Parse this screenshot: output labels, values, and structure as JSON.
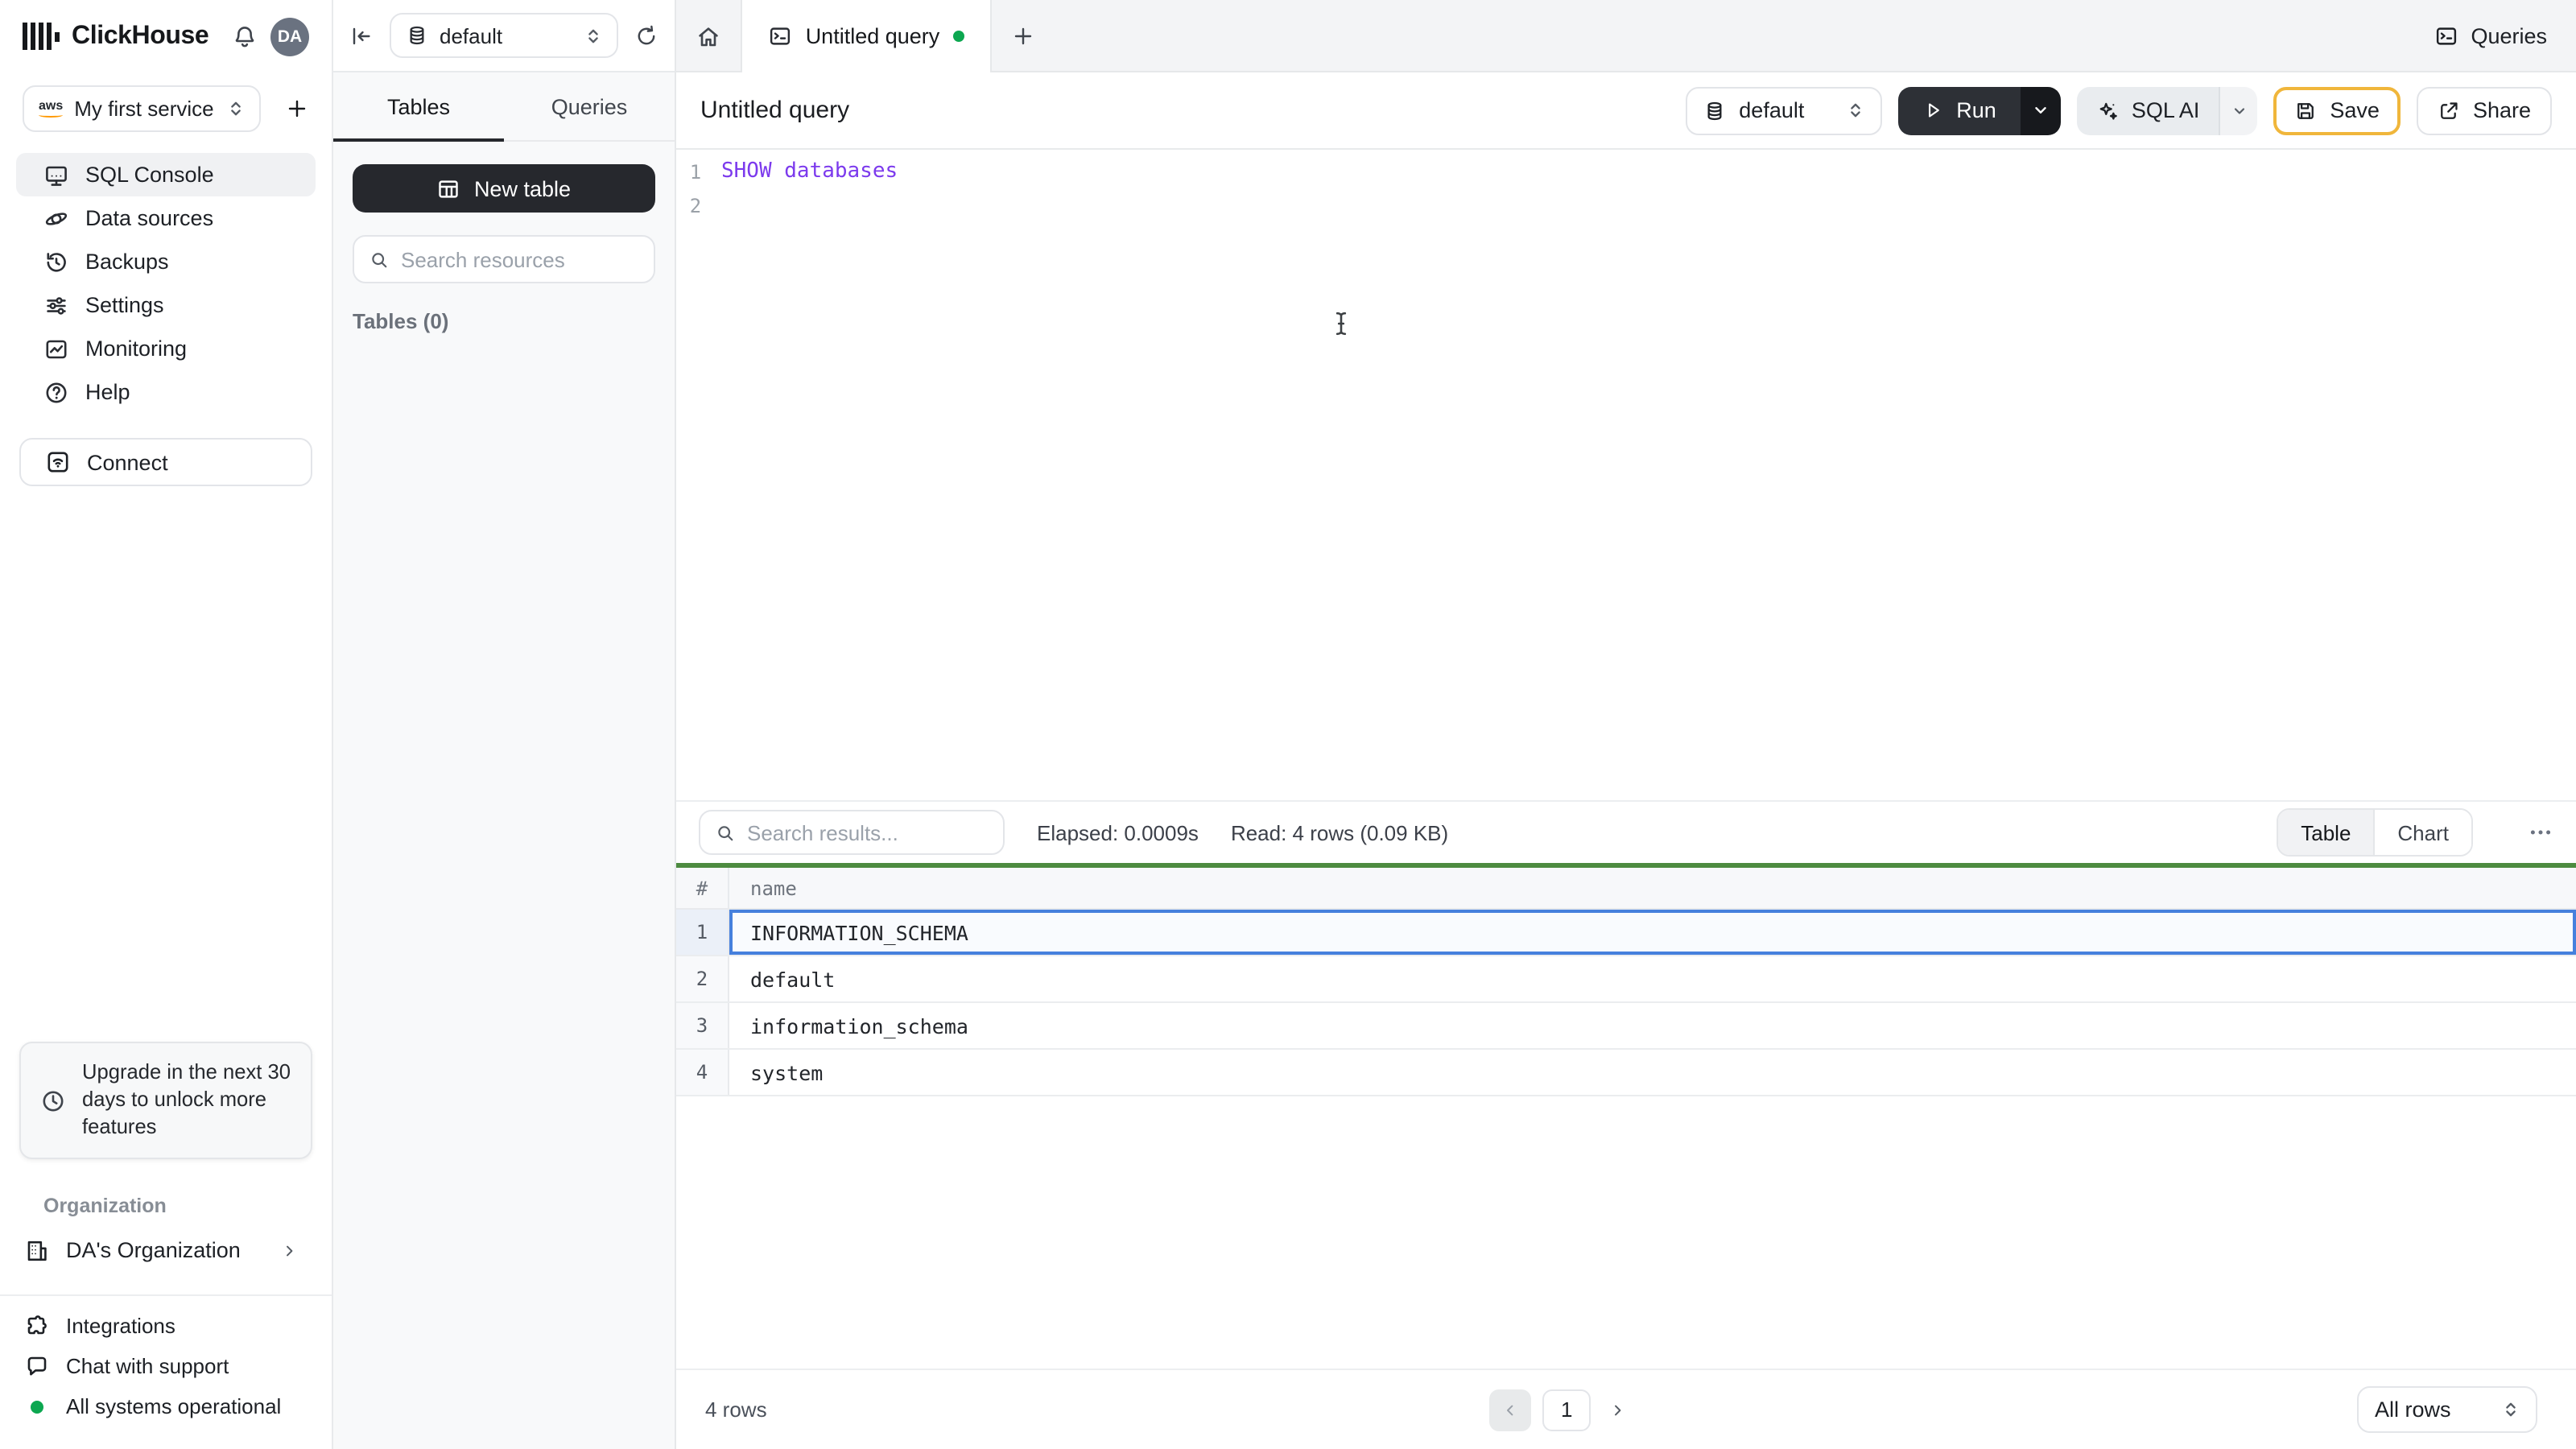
{
  "topbar": {
    "brand": "ClickHouse",
    "avatar_initials": "DA",
    "service_badge": "aws",
    "database_selector": "default",
    "tab_title": "Untitled query",
    "queries_button": "Queries"
  },
  "sidebar": {
    "service_name": "My first service",
    "nav": [
      {
        "label": "SQL Console"
      },
      {
        "label": "Data sources"
      },
      {
        "label": "Backups"
      },
      {
        "label": "Settings"
      },
      {
        "label": "Monitoring"
      },
      {
        "label": "Help"
      }
    ],
    "connect": "Connect",
    "upgrade_notice": "Upgrade in the next 30 days to unlock more features",
    "organization_label": "Organization",
    "organization_name": "DA's Organization",
    "integrations": "Integrations",
    "chat_support": "Chat with support",
    "status": "All systems operational"
  },
  "explorer": {
    "tab_tables": "Tables",
    "tab_queries": "Queries",
    "new_table": "New table",
    "search_placeholder": "Search resources",
    "tables_count": "Tables (0)"
  },
  "query": {
    "title": "Untitled query",
    "database": "default",
    "run": "Run",
    "sql_ai": "SQL AI",
    "save": "Save",
    "share": "Share",
    "lines": [
      {
        "num": "1",
        "code": "SHOW databases"
      },
      {
        "num": "2",
        "code": ""
      }
    ]
  },
  "results": {
    "search_placeholder": "Search results...",
    "elapsed": "Elapsed: 0.0009s",
    "read": "Read: 4 rows (0.09 KB)",
    "view_table": "Table",
    "view_chart": "Chart",
    "headers": {
      "index": "#",
      "name": "name"
    },
    "rows": [
      {
        "num": "1",
        "name": "INFORMATION_SCHEMA"
      },
      {
        "num": "2",
        "name": "default"
      },
      {
        "num": "3",
        "name": "information_schema"
      },
      {
        "num": "4",
        "name": "system"
      }
    ],
    "footer": {
      "total": "4 rows",
      "page": "1",
      "page_size": "All rows"
    }
  },
  "colors": {
    "status_green": "#0ca750",
    "success_bar_green": "#4d8b40",
    "selection_blue": "#4680dd",
    "keyword_purple": "#7c3aed",
    "save_border_gold": "#f0b63b"
  }
}
